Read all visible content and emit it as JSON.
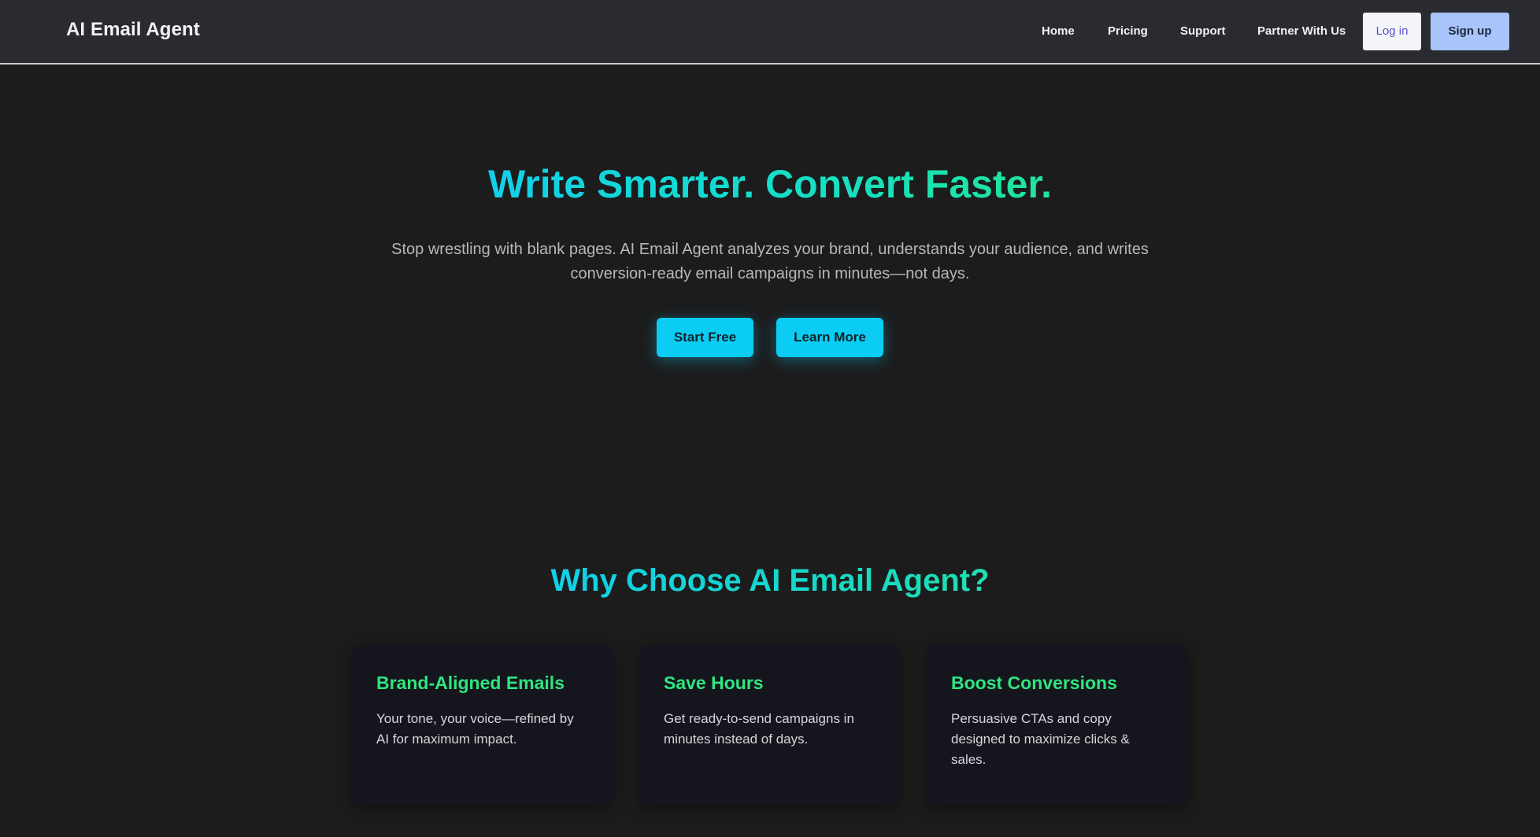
{
  "nav": {
    "brand": "AI Email Agent",
    "links": [
      "Home",
      "Pricing",
      "Support",
      "Partner With Us"
    ],
    "login_label": "Log in",
    "signup_label": "Sign up"
  },
  "hero": {
    "title": "Write Smarter. Convert Faster.",
    "subtitle": "Stop wrestling with blank pages. AI Email Agent analyzes your brand, understands your audience, and writes conversion-ready email campaigns in minutes—not days.",
    "start_label": "Start Free",
    "learn_label": "Learn More"
  },
  "features": {
    "title": "Why Choose AI Email Agent?",
    "cards": [
      {
        "title": "Brand-Aligned Emails",
        "text": "Your tone, your voice—refined by AI for maximum impact."
      },
      {
        "title": "Save Hours",
        "text": "Get ready-to-send campaigns in minutes instead of days."
      },
      {
        "title": "Boost Conversions",
        "text": "Persuasive CTAs and copy designed to maximize clicks & sales."
      }
    ]
  },
  "colors": {
    "background": "#1c1c1d",
    "navbar": "#2a2b30",
    "accent_cyan": "#0bcdf3",
    "accent_green": "#2fe57f",
    "card": "#15161d"
  }
}
